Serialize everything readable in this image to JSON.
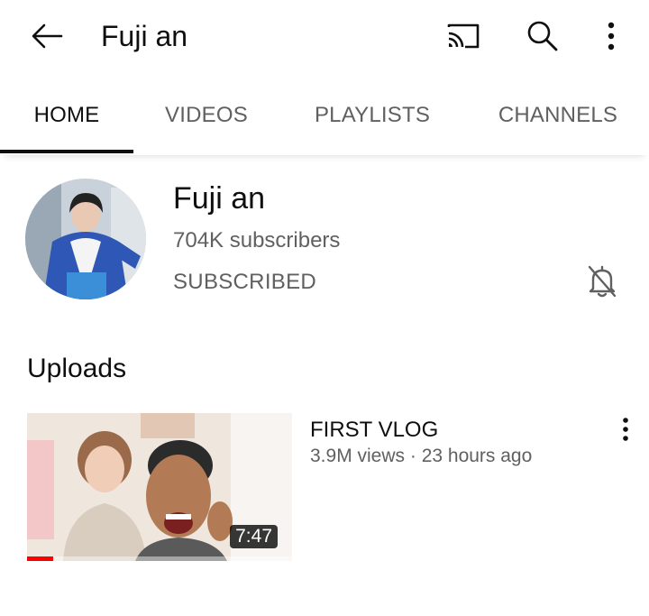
{
  "header": {
    "title": "Fuji an",
    "icons": [
      "back-arrow-icon",
      "cast-icon",
      "search-icon",
      "more-vert-icon"
    ]
  },
  "tabs": [
    {
      "label": "HOME",
      "active": true
    },
    {
      "label": "VIDEOS",
      "active": false
    },
    {
      "label": "PLAYLISTS",
      "active": false
    },
    {
      "label": "CHANNELS",
      "active": false
    }
  ],
  "channel": {
    "name": "Fuji an",
    "subscribers": "704K subscribers",
    "subscribe_state": "SUBSCRIBED",
    "notification_icon": "bell-off-icon"
  },
  "uploads": {
    "section_title": "Uploads",
    "videos": [
      {
        "title": "FIRST VLOG",
        "meta": "3.9M views · 23 hours ago",
        "duration": "7:47",
        "watched_fraction": 0.1
      }
    ]
  },
  "colors": {
    "text_primary": "#0f0f0f",
    "text_secondary": "#606060",
    "progress_red": "#ff0000",
    "background": "#ffffff"
  }
}
